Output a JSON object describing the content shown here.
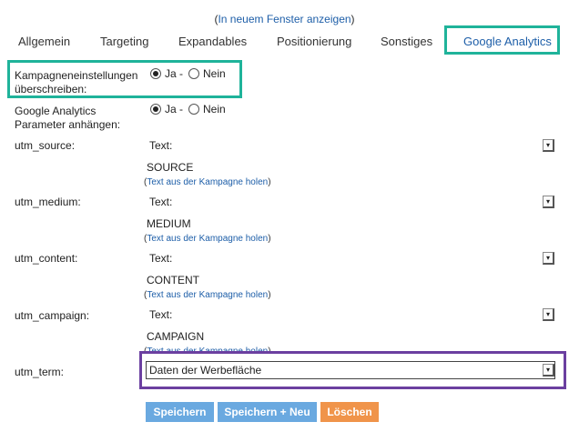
{
  "header": {
    "open_paren": "(",
    "new_window_link": "In neuem Fenster anzeigen",
    "close_paren": ")"
  },
  "tabs": [
    {
      "label": "Allgemein"
    },
    {
      "label": "Targeting"
    },
    {
      "label": "Expandables"
    },
    {
      "label": "Positionierung"
    },
    {
      "label": "Sonstiges"
    },
    {
      "label": "Google Analytics",
      "active": true
    }
  ],
  "settings": {
    "override": {
      "label": "Kampagneneinstellungen überschreiben:",
      "yes": "Ja -",
      "no": "Nein",
      "selected": "yes"
    },
    "append": {
      "label": "Google Analytics Parameter anhängen:",
      "yes": "Ja -",
      "no": "Nein",
      "selected": "yes"
    }
  },
  "fields": [
    {
      "label": "utm_source:",
      "select": "Text:",
      "value": "SOURCE",
      "link_text": "Text aus der Kampagne holen"
    },
    {
      "label": "utm_medium:",
      "select": "Text:",
      "value": "MEDIUM",
      "link_text": "Text aus der Kampagne holen"
    },
    {
      "label": "utm_content:",
      "select": "Text:",
      "value": "CONTENT",
      "link_text": "Text aus der Kampagne holen"
    },
    {
      "label": "utm_campaign:",
      "select": "Text:",
      "value": "CAMPAIGN",
      "link_text": "Text aus der Kampagne holen"
    },
    {
      "label": "utm_term:",
      "select": "Daten der Werbefläche"
    }
  ],
  "buttons": {
    "save": "Speichern",
    "save_new": "Speichern + Neu",
    "delete": "Löschen"
  },
  "colors": {
    "highlight_teal": "#1fb39a",
    "highlight_purple": "#6b3fa0",
    "button_blue": "#6aa9e0",
    "button_orange": "#f0944a",
    "link": "#1d5ea8"
  },
  "icons": {
    "dropdown": "chevron-down-icon",
    "radio": "radio-button"
  }
}
